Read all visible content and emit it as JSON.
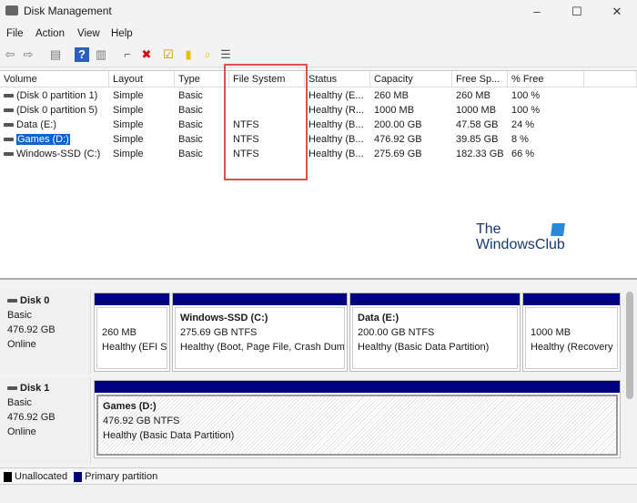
{
  "window": {
    "title": "Disk Management",
    "controls": [
      "–",
      "☐",
      "✕"
    ]
  },
  "menu": [
    "File",
    "Action",
    "View",
    "Help"
  ],
  "toolbar": [
    {
      "icon": "back-arrow-icon",
      "glyph": "⇦"
    },
    {
      "icon": "forward-arrow-icon",
      "glyph": "⇨"
    },
    {
      "icon": "console-tree-icon",
      "glyph": "▤"
    },
    {
      "icon": "help-icon",
      "glyph": "?"
    },
    {
      "icon": "action-pane-icon",
      "glyph": "▥"
    },
    {
      "icon": "connect-icon",
      "glyph": "⌐"
    },
    {
      "icon": "delete-icon",
      "glyph": "✖"
    },
    {
      "icon": "properties-icon",
      "glyph": "☑"
    },
    {
      "icon": "open-folder-icon",
      "glyph": "▮"
    },
    {
      "icon": "search-folder-icon",
      "glyph": "⌕"
    },
    {
      "icon": "list-view-icon",
      "glyph": "☰"
    }
  ],
  "table": {
    "columns": [
      "Volume",
      "Layout",
      "Type",
      "File System",
      "Status",
      "Capacity",
      "Free Sp...",
      "% Free"
    ],
    "rows": [
      [
        "(Disk 0 partition 1)",
        "Simple",
        "Basic",
        "",
        "Healthy (E...",
        "260 MB",
        "260 MB",
        "100 %"
      ],
      [
        "(Disk 0 partition 5)",
        "Simple",
        "Basic",
        "",
        "Healthy (R...",
        "1000 MB",
        "1000 MB",
        "100 %"
      ],
      [
        "Data (E:)",
        "Simple",
        "Basic",
        "NTFS",
        "Healthy (B...",
        "200.00 GB",
        "47.58 GB",
        "24 %"
      ],
      [
        "Games (D:)",
        "Simple",
        "Basic",
        "NTFS",
        "Healthy (B...",
        "476.92 GB",
        "39.85 GB",
        "8 %"
      ],
      [
        "Windows-SSD (C:)",
        "Simple",
        "Basic",
        "NTFS",
        "Healthy (B...",
        "275.69 GB",
        "182.33 GB",
        "66 %"
      ]
    ],
    "selected_row": 3
  },
  "watermark": {
    "line1": "The",
    "line2": "WindowsClub"
  },
  "disks": [
    {
      "name": "Disk 0",
      "type": "Basic",
      "size": "476.92 GB",
      "status": "Online",
      "partitions": [
        {
          "title": "",
          "size": "260 MB",
          "status": "Healthy (EFI Sy"
        },
        {
          "title": "Windows-SSD  (C:)",
          "size": "275.69 GB NTFS",
          "status": "Healthy (Boot, Page File, Crash Dum"
        },
        {
          "title": "Data  (E:)",
          "size": "200.00 GB NTFS",
          "status": "Healthy (Basic Data Partition)"
        },
        {
          "title": "",
          "size": "1000 MB",
          "status": "Healthy (Recovery"
        }
      ]
    },
    {
      "name": "Disk 1",
      "type": "Basic",
      "size": "476.92 GB",
      "status": "Online",
      "partitions": [
        {
          "title": "Games  (D:)",
          "size": "476.92 GB NTFS",
          "status": "Healthy (Basic Data Partition)"
        }
      ]
    }
  ],
  "legend": [
    {
      "label": "Unallocated",
      "color": "#000000"
    },
    {
      "label": "Primary partition",
      "color": "#00007f"
    }
  ],
  "colors": {
    "partition_bar": "#00007f",
    "highlight": "#e05050",
    "selection": "#0a64d0"
  }
}
